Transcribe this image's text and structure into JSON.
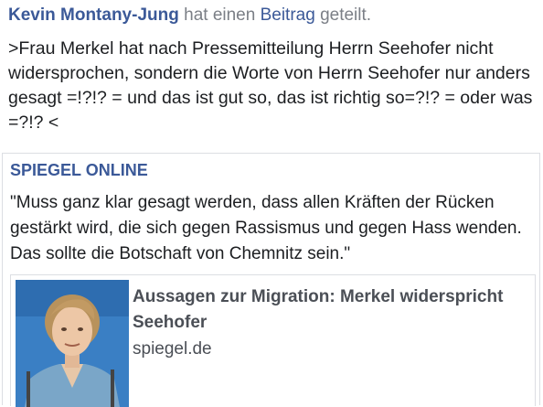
{
  "post": {
    "author": "Kevin Montany-Jung",
    "action_prefix": "hat einen",
    "action_link": "Beitrag",
    "action_suffix": "geteilt.",
    "text": ">Frau Merkel hat nach Pressemitteilung Herrn Seehofer nicht widersprochen, sondern die Worte von Herrn Seehofer nur anders gesagt =!?!? = und das ist gut so, das ist richtig so=?!? = oder was =?!? <"
  },
  "shared": {
    "source": "SPIEGEL ONLINE",
    "quote": "\"Muss ganz klar gesagt werden, dass allen Kräften der Rücken gestärkt wird, die sich gegen Rassismus und gegen Hass wenden. Das sollte die Botschaft von Chemnitz sein.\""
  },
  "link_card": {
    "title": "Aussagen zur Migration: Merkel widerspricht Seehofer",
    "domain": "spiegel.de",
    "image_icon": "portrait-photo"
  },
  "colors": {
    "link_blue": "#3b5998",
    "text": "#1c1e21",
    "muted": "#7b7f86",
    "border": "#dcdee3"
  }
}
